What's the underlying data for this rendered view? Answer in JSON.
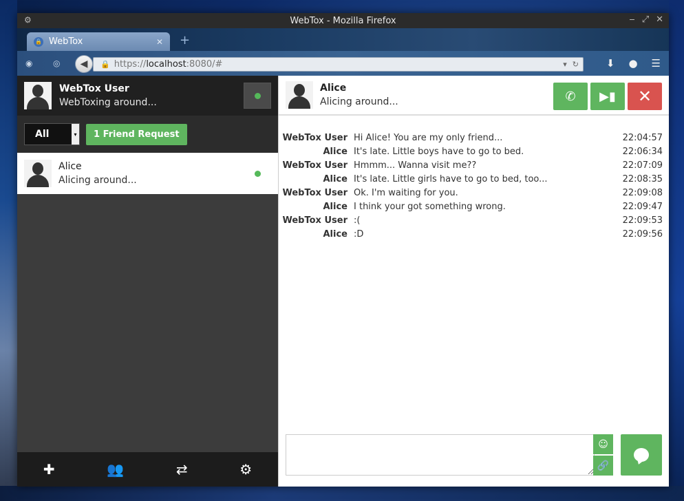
{
  "window": {
    "title": "WebTox - Mozilla Firefox"
  },
  "browser": {
    "tab_title": "WebTox",
    "url_scheme": "https://",
    "url_host": "localhost",
    "url_rest": ":8080/#"
  },
  "profile": {
    "name": "WebTox User",
    "status": "WebToxing around..."
  },
  "filter": {
    "selected": "All",
    "friend_request_label": "1 Friend Request"
  },
  "friends": [
    {
      "name": "Alice",
      "status": "Alicing around..."
    }
  ],
  "chat": {
    "contact_name": "Alice",
    "contact_status": "Alicing around...",
    "messages": [
      {
        "from": "WebTox User",
        "text": "Hi Alice! You are my only friend...",
        "time": "22:04:57"
      },
      {
        "from": "Alice",
        "text": "It's late. Little boys have to go to bed.",
        "time": "22:06:34"
      },
      {
        "from": "WebTox User",
        "text": "Hmmm... Wanna visit me??",
        "time": "22:07:09"
      },
      {
        "from": "Alice",
        "text": "It's late. Little girls have to go to bed, too...",
        "time": "22:08:35"
      },
      {
        "from": "WebTox User",
        "text": "Ok. I'm waiting for you.",
        "time": "22:09:08"
      },
      {
        "from": "Alice",
        "text": "I think your got something wrong.",
        "time": "22:09:47"
      },
      {
        "from": "WebTox User",
        "text": ":(",
        "time": "22:09:53"
      },
      {
        "from": "Alice",
        "text": ":D",
        "time": "22:09:56"
      }
    ]
  },
  "colors": {
    "accent_green": "#5fb55f",
    "danger_red": "#d9534f",
    "online": "#55b95a"
  },
  "icons": {
    "bottombar": [
      "add-icon",
      "group-icon",
      "transfer-icon",
      "settings-icon"
    ],
    "header": [
      "phone-icon",
      "video-icon",
      "close-icon"
    ]
  }
}
